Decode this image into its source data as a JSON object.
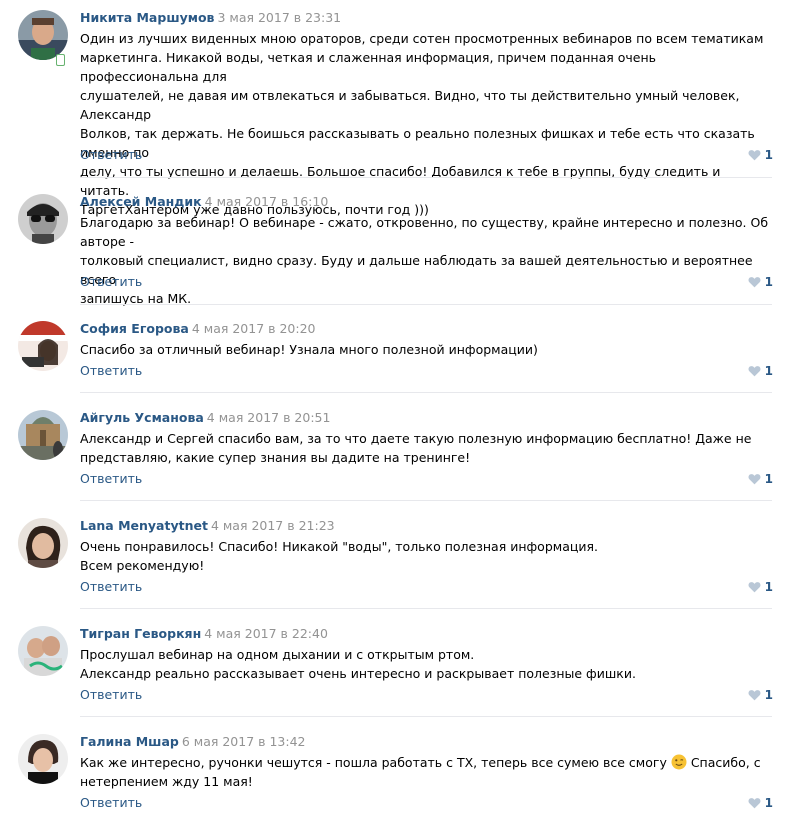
{
  "colors": {
    "link": "#2a5885",
    "date": "#939393",
    "divider": "#e7e8ec",
    "heart": "#b9c7d6"
  },
  "comments": [
    {
      "author": "Никита Маршумов",
      "date": "3 мая 2017 в 23:31",
      "lines": [
        "Один из лучших виденных мною ораторов, среди сотен просмотренных вебинаров по всем тематикам",
        "маркетинга. Никакой воды, четкая и слаженная информация, причем поданная очень профессиональна для",
        "слушателей, не давая им отвлекаться и забываться. Видно, что ты действительно умный человек, Александр",
        "Волков, так держать. Не боишься рассказывать о реально полезных фишках и тебе есть что сказать именно по",
        "делу, что ты успешно и делаешь. Большое спасибо! Добавился к тебе в группы, буду следить и читать.",
        "ТаргетХантером уже давно пользуюсь, почти год )))"
      ],
      "reply": "Ответить",
      "likes": "1",
      "avatar_icon": "avatar-photo"
    },
    {
      "author": "Алексей Мандик",
      "date": "4 мая 2017 в 16:10",
      "lines": [
        "Благодарю за вебинар! О вебинаре - сжато, откровенно, по существу, крайне интересно и полезно. Об авторе -",
        "толковый специалист, видно сразу. Буду и дальше наблюдать за вашей деятельностью и вероятнее всего",
        "запишусь на МК."
      ],
      "reply": "Ответить",
      "likes": "1",
      "avatar_icon": "avatar-photo"
    },
    {
      "author": "София Егорова",
      "date": "4 мая 2017 в 20:20",
      "lines": [
        "Спасибо за отличный вебинар! Узнала много полезной информации)"
      ],
      "reply": "Ответить",
      "likes": "1",
      "avatar_icon": "avatar-photo"
    },
    {
      "author": "Айгуль Усманова",
      "date": "4 мая 2017 в 20:51",
      "lines": [
        "Александр и Сергей спасибо вам, за то что даете такую полезную информацию бесплатно! Даже не",
        "представляю, какие супер знания вы дадите на тренинге!"
      ],
      "reply": "Ответить",
      "likes": "1",
      "avatar_icon": "avatar-photo"
    },
    {
      "author": "Lana Menyatytnet",
      "date": "4 мая 2017 в 21:23",
      "lines": [
        "Очень понравилось! Спасибо! Никакой \"воды\", только полезная информация.",
        "Всем рекомендую!"
      ],
      "reply": "Ответить",
      "likes": "1",
      "avatar_icon": "avatar-photo"
    },
    {
      "author": "Тигран Геворкян",
      "date": "4 мая 2017 в 22:40",
      "lines": [
        "Прослушал вебинар на одном дыхании и с открытым ртом.",
        "Александр реально рассказывает очень интересно и раскрывает полезные фишки."
      ],
      "reply": "Ответить",
      "likes": "1",
      "avatar_icon": "avatar-photo"
    },
    {
      "author": "Галина Мшар",
      "date": "6 мая 2017 в 13:42",
      "lines": [
        "Как же интересно, ручонки чешутся - пошла работать с ТХ, теперь все сумею все смогу",
        "нетерпением жду 11 мая!"
      ],
      "emoji": "winking-face",
      "line_tail": "Спасибо, с",
      "reply": "Ответить",
      "likes": "1",
      "avatar_icon": "avatar-photo"
    }
  ]
}
